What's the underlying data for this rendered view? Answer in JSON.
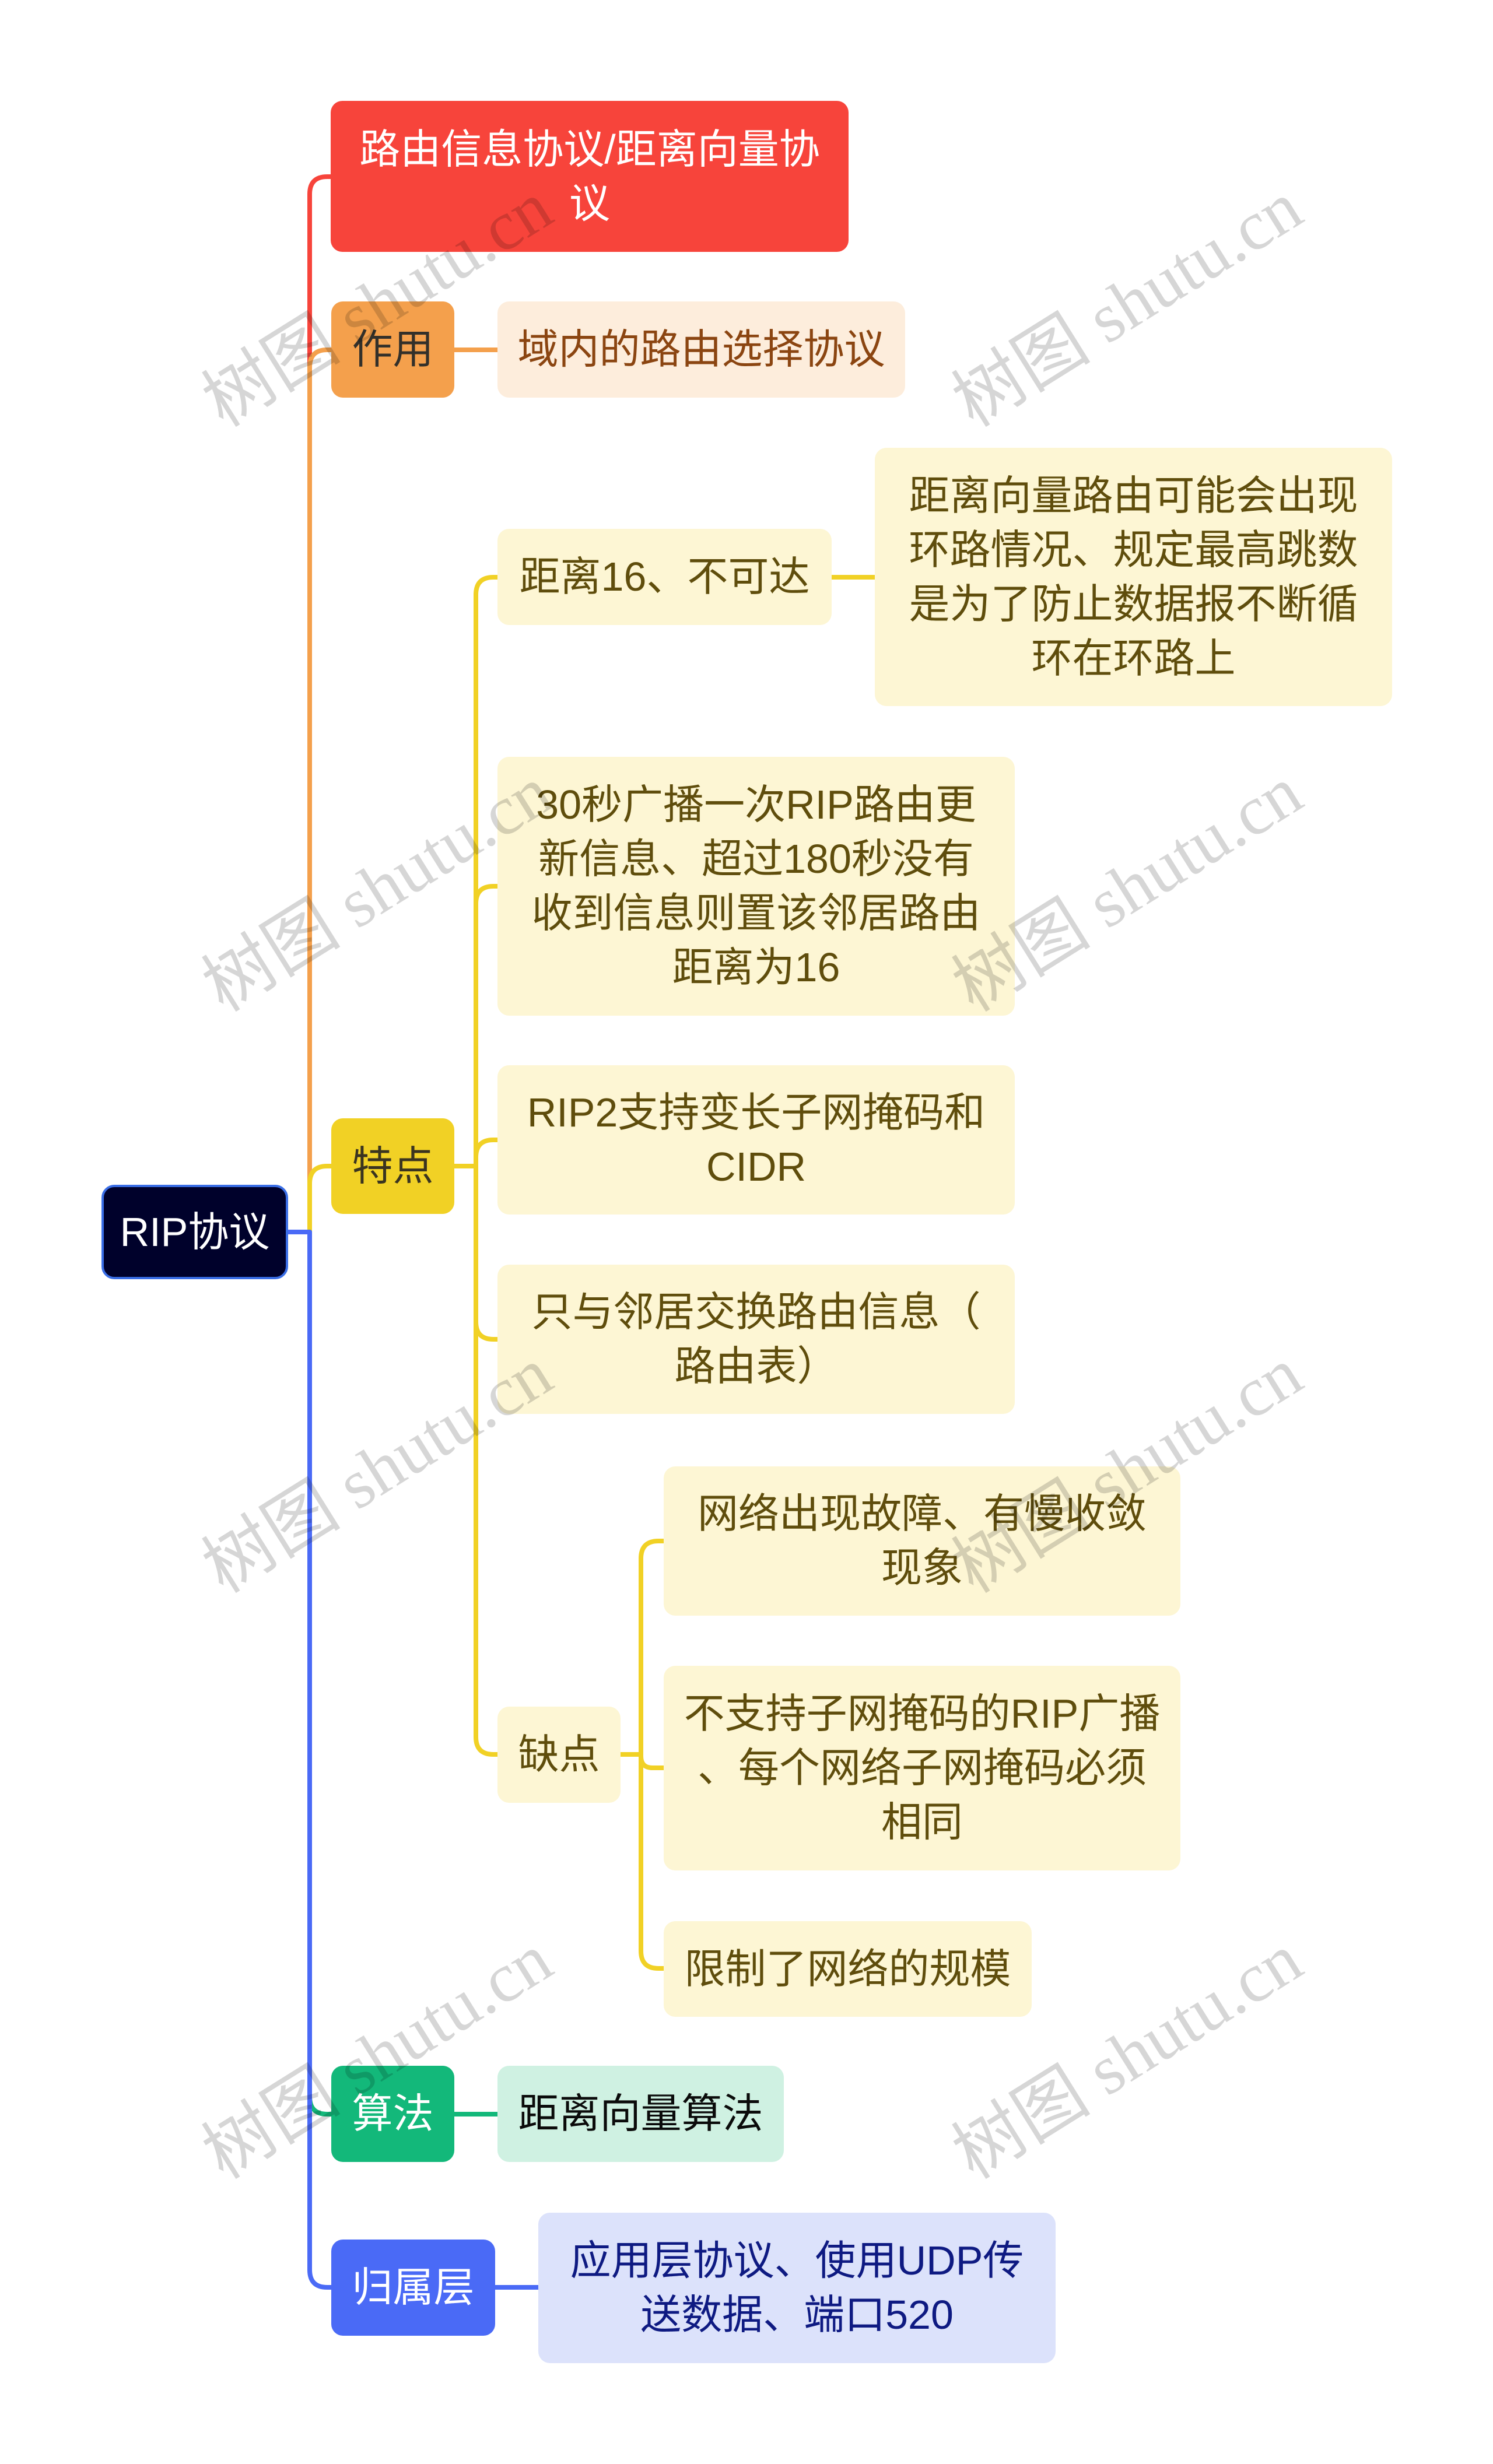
{
  "title": "RIP协议",
  "mindmap": {
    "root": {
      "label": "RIP协议"
    },
    "branches": [
      {
        "label": "路由信息协议/距离向量协\n议"
      },
      {
        "label": "作用",
        "children": [
          {
            "label": "域内的路由选择协议"
          }
        ]
      },
      {
        "label": "特点",
        "children": [
          {
            "label": "距离16、不可达",
            "children": [
              {
                "label": "距离向量路由可能会出现\n环路情况、规定最高跳数\n是为了防止数据报不断循\n环在环路上"
              }
            ]
          },
          {
            "label": "30秒广播一次RIP路由更\n新信息、超过180秒没有\n收到信息则置该邻居路由\n距离为16"
          },
          {
            "label": "RIP2支持变长子网掩码和\nCIDR"
          },
          {
            "label": "只与邻居交换路由信息（\n路由表）"
          },
          {
            "label": "缺点",
            "children": [
              {
                "label": "网络出现故障、有慢收敛\n现象"
              },
              {
                "label": "不支持子网掩码的RIP广播\n、每个网络子网掩码必须\n相同"
              },
              {
                "label": "限制了网络的规模"
              }
            ]
          }
        ]
      },
      {
        "label": "算法",
        "children": [
          {
            "label": "距离向量算法"
          }
        ]
      },
      {
        "label": "归属层",
        "children": [
          {
            "label": "应用层协议、使用UDP传\n送数据、端口520"
          }
        ]
      }
    ]
  },
  "theme": {
    "root-bg": "#00012b",
    "root-border": "#3a6ee6",
    "root-text": "#ffffff",
    "red": "#f7443b",
    "red-text": "#ffffff",
    "orange": "#f4a04c",
    "orange-label": "#33302a",
    "orange-light": "#fdeddc",
    "orange-text": "#8b4511",
    "yellow": "#f1d125",
    "yellow-label": "#3a3420",
    "yellow-light": "#fdf6d4",
    "yellow-text": "#5f4d0c",
    "green": "#13b87a",
    "green-label": "#ffffff",
    "green-light": "#cff1e2",
    "green-text": "#0b0b0b",
    "blue": "#4a6af6",
    "blue-label": "#ffffff",
    "blue-light": "#dce2fb",
    "blue-text": "#0e1a82"
  },
  "watermark": {
    "text": "树图 shutu.cn"
  }
}
